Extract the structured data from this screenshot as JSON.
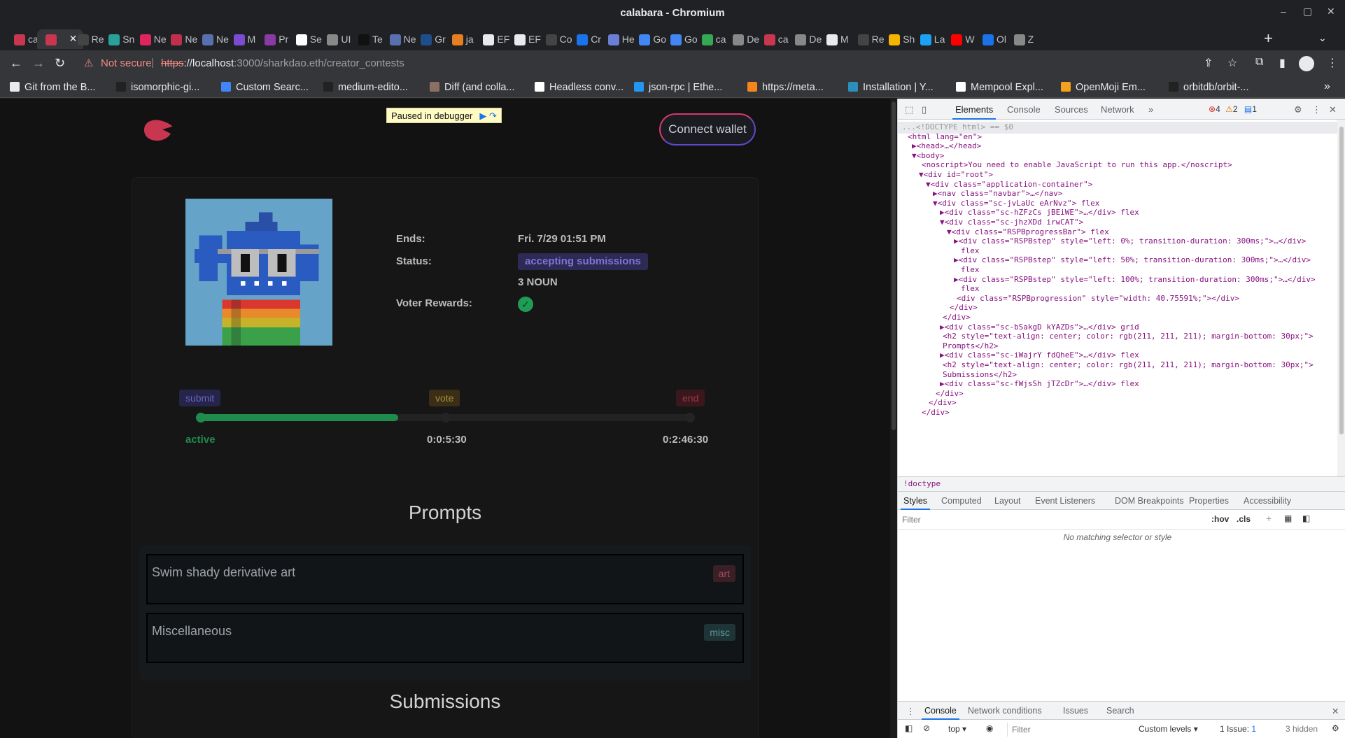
{
  "window": {
    "title": "calabara - Chromium",
    "controls": [
      "–",
      "▢",
      "✕"
    ]
  },
  "tabs": [
    {
      "label": "ca",
      "color": "#c8364f"
    },
    {
      "label": "",
      "color": "#c8364f",
      "active": true
    },
    {
      "label": "Re",
      "color": "#444"
    },
    {
      "label": "Sn",
      "color": "#2aa198"
    },
    {
      "label": "Ne",
      "color": "#e0245e"
    },
    {
      "label": "Ne",
      "color": "#c0304a"
    },
    {
      "label": "Ne",
      "color": "#5a6fb0"
    },
    {
      "label": "M",
      "color": "#7b4bd1"
    },
    {
      "label": "Pr",
      "color": "#8a3aa3"
    },
    {
      "label": "Se",
      "color": "#ffffff"
    },
    {
      "label": "UI",
      "color": "#888"
    },
    {
      "label": "Te",
      "color": "#111"
    },
    {
      "label": "Ne",
      "color": "#5a6fb0"
    },
    {
      "label": "Gr",
      "color": "#1d4e89"
    },
    {
      "label": "ja",
      "color": "#e67e22"
    },
    {
      "label": "EF",
      "color": "#e8eaed"
    },
    {
      "label": "EF",
      "color": "#e8eaed"
    },
    {
      "label": "Co",
      "color": "#444"
    },
    {
      "label": "Cr",
      "color": "#1a73e8"
    },
    {
      "label": "He",
      "color": "#6c7fd6"
    },
    {
      "label": "Go",
      "color": "#4285f4"
    },
    {
      "label": "Go",
      "color": "#4285f4"
    },
    {
      "label": "ca",
      "color": "#34a853"
    },
    {
      "label": "De",
      "color": "#888"
    },
    {
      "label": "ca",
      "color": "#c8364f"
    },
    {
      "label": "De",
      "color": "#888"
    },
    {
      "label": "M",
      "color": "#e8eaed"
    },
    {
      "label": "Re",
      "color": "#444"
    },
    {
      "label": "Sh",
      "color": "#f4b400"
    },
    {
      "label": "La",
      "color": "#1da1f2"
    },
    {
      "label": "W",
      "color": "#ff0000"
    },
    {
      "label": "Ol",
      "color": "#1a73e8"
    },
    {
      "label": "Z",
      "color": "#888"
    }
  ],
  "tab_close": "✕",
  "new_tab": "+",
  "tab_search": "⌄",
  "toolbar": {
    "back": "←",
    "forward": "→",
    "reload": "↻",
    "warning_icon": "⚠",
    "not_secure": "Not secure",
    "separator": "|",
    "url_scheme": "https",
    "url_host": "://localhost",
    "url_rest": ":3000/sharkdao.eth/creator_contests",
    "share": "⇪",
    "star": "☆",
    "extensions": "⧉",
    "sidepanel": "▮",
    "menu": "⋮"
  },
  "bookmarks": [
    {
      "label": "Git from the B...",
      "color": "#e8eaed"
    },
    {
      "label": "isomorphic-gi...",
      "color": "#222"
    },
    {
      "label": "Custom Searc...",
      "color": "#4285f4"
    },
    {
      "label": "medium-edito...",
      "color": "#222"
    },
    {
      "label": "Diff (and colla...",
      "color": "#8d6e63"
    },
    {
      "label": "Headless conv...",
      "color": "#ffffff"
    },
    {
      "label": "json-rpc | Ethe...",
      "color": "#2196f3"
    },
    {
      "label": "https://meta...",
      "color": "#f6851b"
    },
    {
      "label": "Installation | Y...",
      "color": "#2c8ebb"
    },
    {
      "label": "Mempool Expl...",
      "color": "#ffffff"
    },
    {
      "label": "OpenMoji Em...",
      "color": "#f4a21b"
    },
    {
      "label": "orbitdb/orbit-...",
      "color": "#222"
    }
  ],
  "bookmarks_more": "»",
  "app": {
    "debugger_banner": "Paused in debugger",
    "debugger_icons": "▶ ↷",
    "connect_wallet": "Connect wallet",
    "meta": {
      "ends_label": "Ends:",
      "ends_value": "Fri. 7/29 01:51 PM",
      "status_label": "Status:",
      "status_value": "accepting submissions",
      "reward": "3 NOUN",
      "voter_rewards_label": "Voter Rewards:",
      "voter_rewards_icon": "✓"
    },
    "progress": {
      "stages": [
        "submit",
        "vote",
        "end"
      ],
      "fraction": 0.4075591,
      "active_label": "active",
      "vote_timer": "0:0:5:30",
      "end_timer": "0:2:46:30"
    },
    "prompts_heading": "Prompts",
    "prompts": [
      {
        "text": "Swim shady derivative art",
        "tag": "art",
        "tag_bg": "#3a1f26",
        "tag_fg": "#a0505e"
      },
      {
        "text": "Miscellaneous",
        "tag": "misc",
        "tag_bg": "#1f3436",
        "tag_fg": "#5a9a9e"
      }
    ],
    "submissions_heading": "Submissions"
  },
  "devtools": {
    "tabs": [
      "Elements",
      "Console",
      "Sources",
      "Network"
    ],
    "more": "»",
    "errors": "4",
    "warnings": "2",
    "messages": "1",
    "gear": "⚙",
    "kebab": "⋮",
    "close": "✕",
    "breadcrumb": "!doctype",
    "style_tabs": [
      "Styles",
      "Computed",
      "Layout",
      "Event Listeners",
      "DOM Breakpoints",
      "Properties",
      "Accessibility"
    ],
    "filter_placeholder": "Filter",
    "hov": ":hov",
    "cls": ".cls",
    "no_match": "No matching selector or style",
    "drawer_tabs": [
      "Console",
      "Network conditions",
      "Issues",
      "Search"
    ],
    "context": "top ▾",
    "console_filter": "Filter",
    "custom_levels": "Custom levels ▾",
    "issue_count": "1 Issue: ",
    "issue_badge": "1",
    "hidden": "3 hidden"
  },
  "dom_lines": [
    "...<!DOCTYPE html> == $0",
    "<html lang=\"en\">",
    "▶<head>…</head>",
    "▼<body>",
    "<noscript>You need to enable JavaScript to run this app.</noscript>",
    "▼<div id=\"root\">",
    "▼<div class=\"application-container\">",
    "▶<nav class=\"navbar\">…</nav>",
    "▼<div class=\"sc-jvLaUc eArNvz\"> flex",
    "▶<div class=\"sc-hZFzCs jBEiWE\">…</div> flex",
    "▼<div class=\"sc-jhzXDd irwCAT\">",
    "▼<div class=\"RSPBprogressBar\"> flex",
    "▶<div class=\"RSPBstep\" style=\"left: 0%; transition-duration: 300ms;\">…</div>",
    "flex",
    "▶<div class=\"RSPBstep\" style=\"left: 50%; transition-duration: 300ms;\">…</div>",
    "flex",
    "▶<div class=\"RSPBstep\" style=\"left: 100%; transition-duration: 300ms;\">…</div>",
    "flex",
    "<div class=\"RSPBprogression\" style=\"width: 40.75591%;\"></div>",
    "</div>",
    "</div>",
    "▶<div class=\"sc-bSakgD kYAZDs\">…</div> grid",
    "<h2 style=\"text-align: center; color: rgb(211, 211, 211); margin-bottom: 30px;\">",
    "Prompts</h2>",
    "▶<div class=\"sc-iWajrY fdQheE\">…</div> flex",
    "<h2 style=\"text-align: center; color: rgb(211, 211, 211); margin-bottom: 30px;\">",
    "Submissions</h2>",
    "▶<div class=\"sc-fWjsSh jTZcDr\">…</div> flex",
    "</div>",
    "</div>",
    "</div>"
  ]
}
